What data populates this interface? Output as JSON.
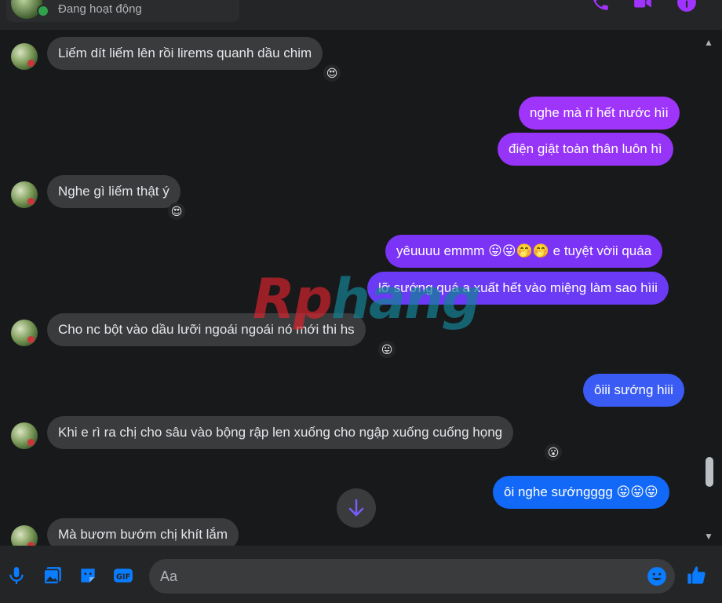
{
  "header": {
    "status": "Đang hoạt động"
  },
  "colors": {
    "outgoing_start": "#a033ff",
    "outgoing_end": "#0a7cff",
    "incoming": "#3a3b3c",
    "accent": "#0a7cff"
  },
  "messages": [
    {
      "side": "in",
      "text": "Liếm dít liếm lên rồi lirems quanh dầu chim",
      "reaction": "😍"
    },
    {
      "side": "out",
      "text": "nghe mà rỉ hết nước hìi"
    },
    {
      "side": "out",
      "text": "điện giật toàn thân luôn hì"
    },
    {
      "side": "in",
      "text": "Nghe gì liếm thật ý",
      "reaction": "😍"
    },
    {
      "side": "out",
      "text": "yêuuuu emmm 😛😛🤭🤭 e tuyệt vờii quáa"
    },
    {
      "side": "out",
      "text": "lỡ sướng quá a xuất hết vào miệng làm sao hìii"
    },
    {
      "side": "in",
      "text": "Cho nc bột vào dầu  lưỡi ngoái ngoái  nó mới thi hs",
      "reaction": "😛"
    },
    {
      "side": "out",
      "text": "ôiii sướng hiii"
    },
    {
      "side": "in",
      "text": "Khi e rì ra chị cho  sâu vào  bộng rập len xuống  cho ngập xuống cuống họng",
      "reaction": "😮"
    },
    {
      "side": "out",
      "text": "ôi nghe sướngggg 😛😛😛"
    },
    {
      "side": "in",
      "text": "Mà bươm bướm chị khít lắm"
    }
  ],
  "watermark": {
    "part1": "Rp",
    "part2": "hang"
  },
  "composer": {
    "placeholder": "Aa",
    "icons": [
      "microphone-icon",
      "image-icon",
      "sticker-icon",
      "gif-icon",
      "emoji-icon",
      "like-icon"
    ]
  }
}
